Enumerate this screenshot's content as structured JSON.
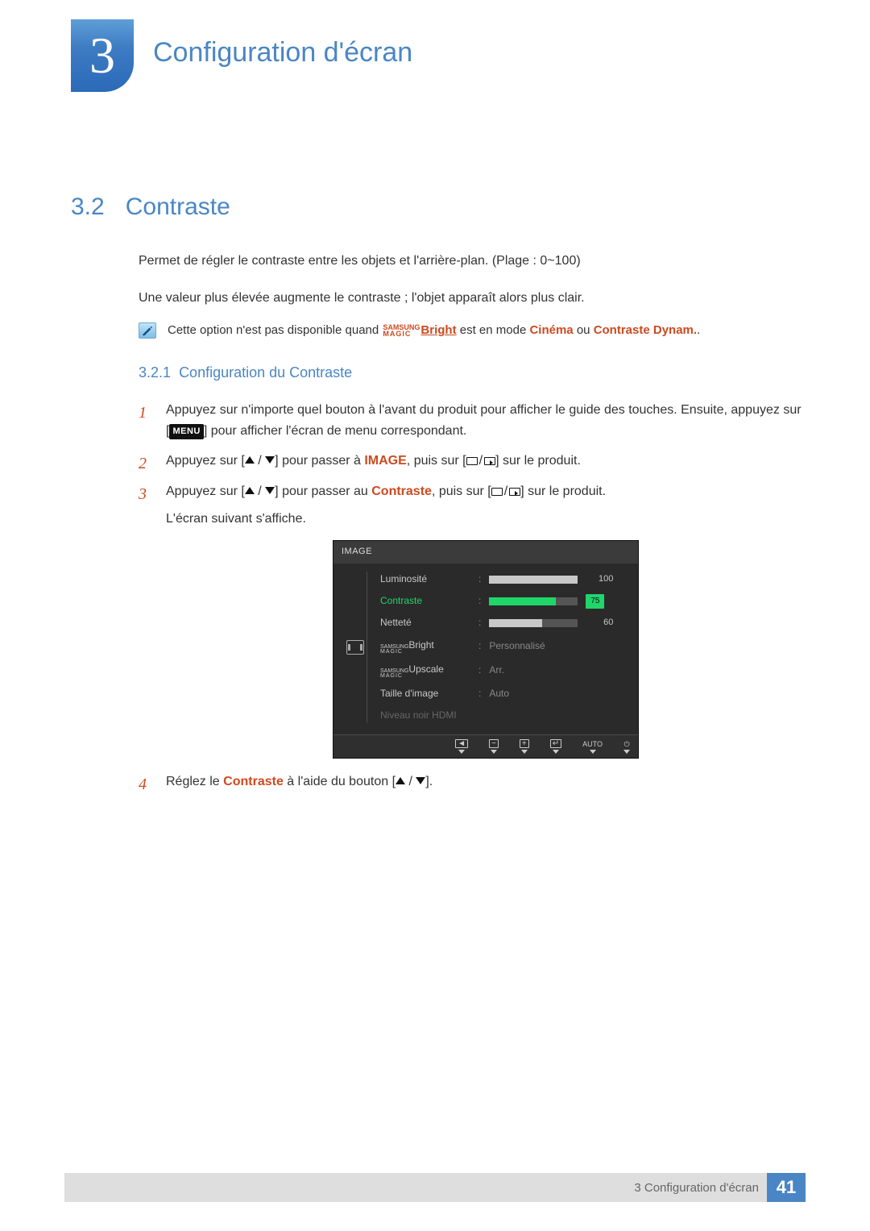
{
  "chapter": {
    "number": "3",
    "title": "Configuration d'écran"
  },
  "section": {
    "number": "3.2",
    "title": "Contraste"
  },
  "intro": {
    "p1": "Permet de régler le contraste entre les objets et l'arrière-plan. (Plage : 0~100)",
    "p2": "Une valeur plus élevée augmente le contraste ; l'objet apparaît alors plus clair."
  },
  "note": {
    "prefix": "Cette option n'est pas disponible quand ",
    "magic_top": "SAMSUNG",
    "magic_bottom": "MAGIC",
    "bright_label": "Bright",
    "mid": " est en mode ",
    "m1": "Cinéma",
    "or": " ou ",
    "m2": "Contraste Dynam.",
    "end": "."
  },
  "subsection": {
    "number": "3.2.1",
    "title": "Configuration du Contraste"
  },
  "steps": {
    "s1a": "Appuyez sur n'importe quel bouton à l'avant du produit pour afficher le guide des touches. Ensuite, appuyez sur [",
    "s1_menu": "MENU",
    "s1b": "] pour afficher l'écran de menu correspondant.",
    "s2a": "Appuyez sur [",
    "s2b": "] pour passer à ",
    "s2_image": "IMAGE",
    "s2c": ", puis sur [",
    "s2d": "] sur le produit.",
    "s3a": "Appuyez sur [",
    "s3b": "] pour passer au ",
    "s3_contraste": "Contraste",
    "s3c": ", puis sur [",
    "s3d": "] sur le produit.",
    "s3e": "L'écran suivant s'affiche.",
    "s4a": "Réglez le ",
    "s4_contraste": "Contraste",
    "s4b": " à l'aide du bouton [",
    "s4c": "]."
  },
  "osd": {
    "title": "IMAGE",
    "rows": [
      {
        "label": "Luminosité",
        "value": "100",
        "fill": 100
      },
      {
        "label": "Contraste",
        "value": "75",
        "fill": 75,
        "selected": true
      },
      {
        "label": "Netteté",
        "value": "60",
        "fill": 60
      },
      {
        "label_magic": "Bright",
        "text": "Personnalisé"
      },
      {
        "label_magic": "Upscale",
        "text": "Arr."
      },
      {
        "label": "Taille d'image",
        "text": "Auto"
      },
      {
        "label": "Niveau noir HDMI",
        "dim": true
      }
    ],
    "footer_auto": "AUTO"
  },
  "footer": {
    "text": "3 Configuration d'écran",
    "page": "41"
  }
}
